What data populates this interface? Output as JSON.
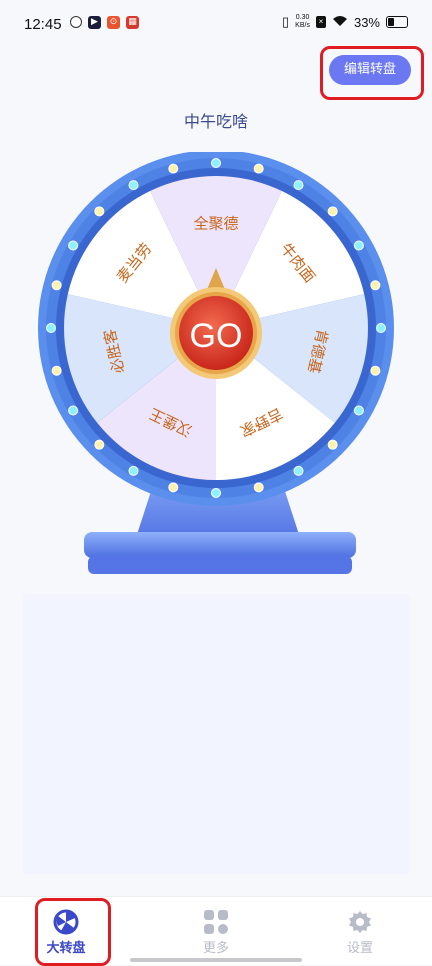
{
  "status_bar": {
    "time": "12:45",
    "net_speed_value": "0.30",
    "net_speed_unit": "KB/s",
    "battery_percent": "33%"
  },
  "header": {
    "edit_button_label": "编辑转盘"
  },
  "wheel": {
    "title": "中午吃啥",
    "go_label": "GO",
    "segments": [
      {
        "label": "全聚德",
        "color": "#ede5fb"
      },
      {
        "label": "牛肉面",
        "color": "#ffffff"
      },
      {
        "label": "肯德基",
        "color": "#d8e5fb"
      },
      {
        "label": "吉野家",
        "color": "#ffffff"
      },
      {
        "label": "汉堡王",
        "color": "#ede5fb"
      },
      {
        "label": "必胜客",
        "color": "#d8e5fb"
      },
      {
        "label": "麦当劳",
        "color": "#ffffff"
      }
    ],
    "text_color": "#c8651b",
    "rim_color": "#4e82e4"
  },
  "bottom_nav": {
    "wheel_label": "大转盘",
    "more_label": "更多",
    "settings_label": "设置"
  }
}
